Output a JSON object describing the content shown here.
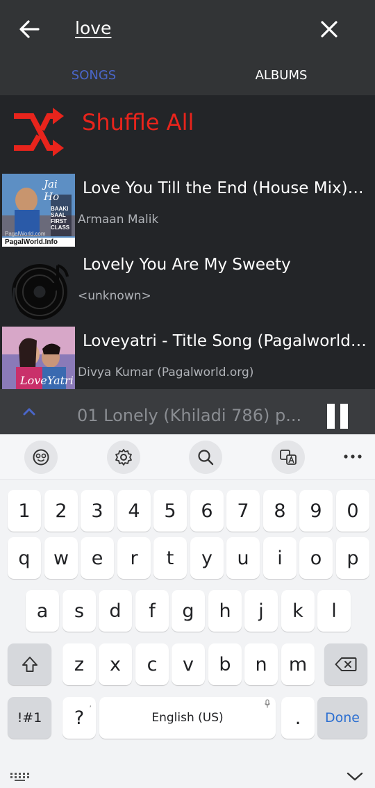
{
  "search": {
    "query": "love"
  },
  "tabs": [
    {
      "label": "SONGS"
    },
    {
      "label": "ALBUMS"
    }
  ],
  "shuffle": {
    "label": "Shuffle All"
  },
  "songs": [
    {
      "title": "Love You Till the End (House Mix) - P..",
      "artist": "Armaan Malik"
    },
    {
      "title": "Lovely You Are My Sweety",
      "artist": "<unknown>"
    },
    {
      "title": "Loveyatri - Title Song (Pagalworld.or..",
      "artist": "Divya Kumar (Pagalworld.org)"
    }
  ],
  "artwork": {
    "song1": {
      "overlay": "Jai Ho",
      "small_text": "BAAKI SAAL FIRST CLASS",
      "watermark_top": "PagalWorld.com",
      "watermark": "PagalWorld.Info"
    },
    "song3": {
      "overlay": "LoveYatri"
    }
  },
  "now_playing": {
    "title": "01 Lonely (Khiladi 786) p..."
  },
  "keyboard": {
    "row1": [
      "1",
      "2",
      "3",
      "4",
      "5",
      "6",
      "7",
      "8",
      "9",
      "0"
    ],
    "row2": [
      "q",
      "w",
      "e",
      "r",
      "t",
      "y",
      "u",
      "i",
      "o",
      "p"
    ],
    "row3": [
      "a",
      "s",
      "d",
      "f",
      "g",
      "h",
      "j",
      "k",
      "l"
    ],
    "row4": [
      "z",
      "x",
      "c",
      "v",
      "b",
      "n",
      "m"
    ],
    "symbols_label": "!#1",
    "question": "?",
    "comma_hint": ",",
    "space_label": "English (US)",
    "period": ".",
    "done_label": "Done"
  },
  "colors": {
    "accent_tab": "#4a66c9",
    "shuffle_red": "#e8241c",
    "done_blue": "#2c6fd1",
    "app_bg": "#232528",
    "topbar_bg": "#323436"
  },
  "icons": [
    "back-arrow-icon",
    "close-icon",
    "shuffle-icon",
    "chevron-up-icon",
    "pause-icon",
    "emoji-icon",
    "settings-icon",
    "search-icon",
    "translate-icon",
    "more-icon",
    "shift-icon",
    "backspace-icon",
    "mic-icon",
    "keyboard-icon",
    "chevron-down-icon"
  ]
}
